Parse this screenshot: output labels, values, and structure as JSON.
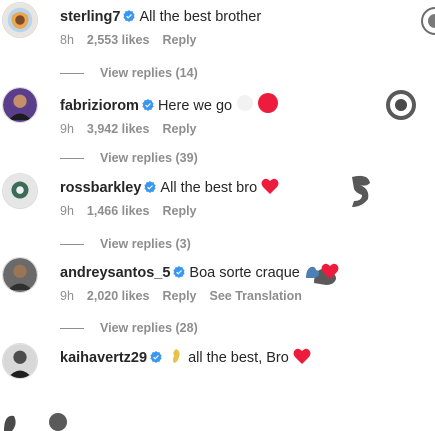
{
  "comments": [
    {
      "username": "sterling7",
      "text": "All the best brother",
      "time": "8h",
      "likes": "2,553 likes",
      "reply": "Reply",
      "view_replies": "View replies (14)"
    },
    {
      "username": "fabriziorom",
      "text": "Here we go",
      "time": "9h",
      "likes": "3,942 likes",
      "reply": "Reply",
      "view_replies": "View replies (39)"
    },
    {
      "username": "rossbarkley",
      "text": "All the best bro",
      "time": "9h",
      "likes": "1,466 likes",
      "reply": "Reply",
      "view_replies": "View replies (3)"
    },
    {
      "username": "andreysantos_5",
      "text": "Boa sorte craque",
      "time": "9h",
      "likes": "2,020 likes",
      "reply": "Reply",
      "see_translation": "See Translation",
      "view_replies": "View replies (28)"
    },
    {
      "username": "kaihavertz29",
      "text": "all the best, Bro"
    }
  ],
  "colors": {
    "verified": "#3897f0",
    "heart": "#ed1c3c",
    "meta_text": "#8e8e8e",
    "primary_text": "#262626"
  },
  "icons": [
    "verified-badge-icon",
    "red-heart-icon",
    "fist-bump-icon",
    "flexed-bicep-icon",
    "hands-icon"
  ]
}
